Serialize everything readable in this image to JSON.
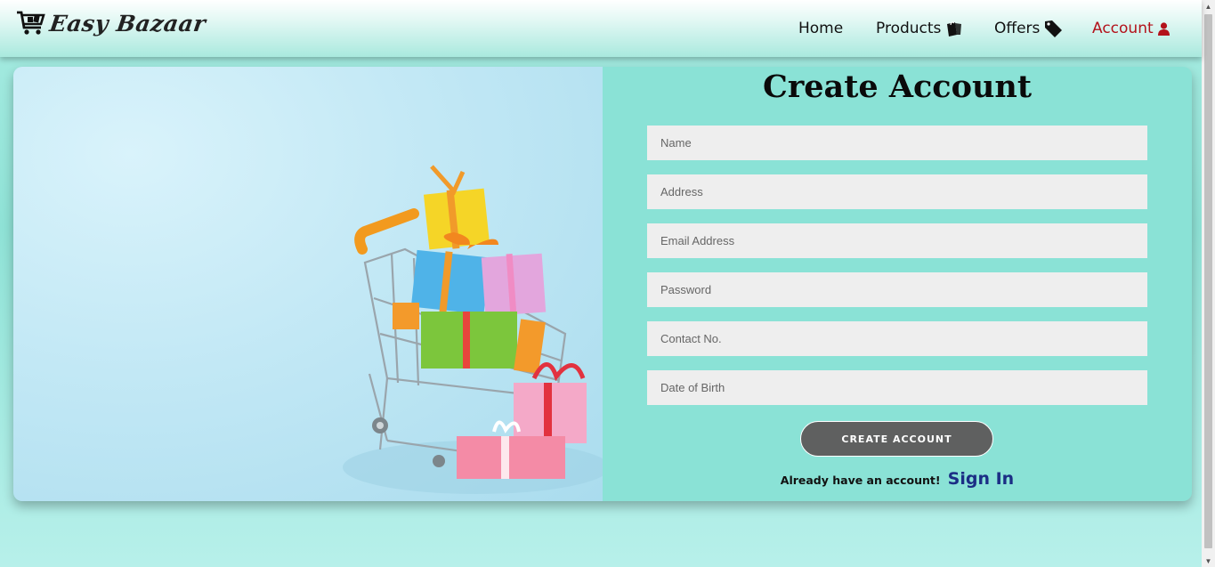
{
  "brand": {
    "name": "Easy Bazaar",
    "logo_icon": "shopping-cart-icon"
  },
  "nav": {
    "items": [
      {
        "label": "Home",
        "icon": ""
      },
      {
        "label": "Products",
        "icon": "shopping-bag-icon"
      },
      {
        "label": "Offers",
        "icon": "tag-icon"
      },
      {
        "label": "Account",
        "icon": "user-icon",
        "active": true
      }
    ]
  },
  "hero": {
    "image": "shopping-cart-with-gift-boxes"
  },
  "form": {
    "title": "Create Account",
    "fields": [
      {
        "placeholder": "Name",
        "value": ""
      },
      {
        "placeholder": "Address",
        "value": ""
      },
      {
        "placeholder": "Email Address",
        "value": ""
      },
      {
        "placeholder": "Password",
        "value": ""
      },
      {
        "placeholder": "Contact No.",
        "value": ""
      },
      {
        "placeholder": "Date of Birth",
        "value": ""
      }
    ],
    "submit_label": "CREATE ACCOUNT",
    "signin_prompt": "Already have an account!",
    "signin_link": "Sign In"
  },
  "colors": {
    "accent": "#8ae2d6",
    "active_nav": "#b3121b",
    "button": "#5f6060",
    "link": "#1b2e85"
  }
}
